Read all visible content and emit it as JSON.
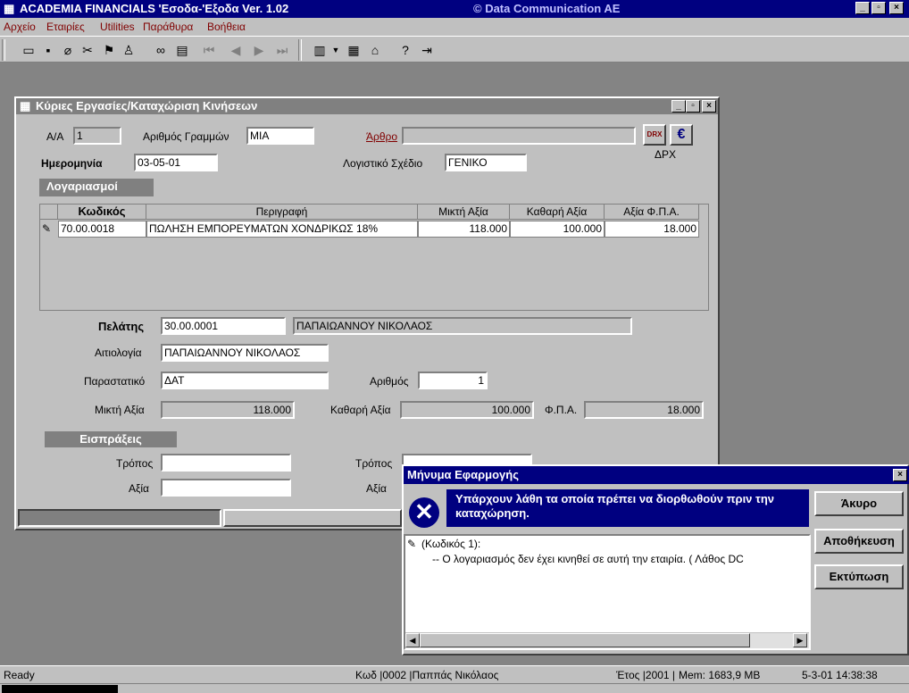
{
  "app": {
    "title": "ACADEMIA FINANCIALS 'Εσοδα-'Εξοδα Ver. 1.02",
    "company": "© Data Communication AE",
    "controls": {
      "minimize": "_",
      "maximize": "▫",
      "close": "×"
    }
  },
  "menu": [
    "Αρχείο",
    "Εταιρίες",
    "Utilities",
    "Παράθυρα",
    "Βοήθεια"
  ],
  "toolbar": {
    "icons": [
      "open-icon",
      "save-icon",
      "eraser-icon",
      "cut-icon",
      "flag-icon",
      "users-icon",
      "binoculars-icon",
      "calendar-icon",
      "first-record-icon",
      "prev-record-icon",
      "next-record-icon",
      "last-record-icon",
      "columns-icon",
      "list-icon",
      "building-icon",
      "help-icon",
      "exit-icon"
    ]
  },
  "child": {
    "title": "Κύριες Εργασίες/Καταχώριση Κινήσεων",
    "aa_label": "Α/Α",
    "aa_value": "1",
    "lines_label": "Αριθμός Γραμμών",
    "lines_value": "ΜΙΑ",
    "article_label": "Άρθρο",
    "article_value": "",
    "drx_label": "ΔΡΧ",
    "date_label": "Ημερομηνία",
    "date_value": "03-05-01",
    "plan_label": "Λογιστικό Σχέδιο",
    "plan_value": "ΓΕΝΙΚΟ",
    "accounts_header": "Λογαριασμοί",
    "grid": {
      "headers": [
        "Κωδικός",
        "Περιγραφή",
        "Μικτή Αξία",
        "Καθαρή Αξία",
        "Αξία Φ.Π.Α."
      ],
      "rows": [
        {
          "code": "70.00.0018",
          "desc": "ΠΩΛΗΣΗ ΕΜΠΟΡΕΥΜΑΤΩΝ ΧΟΝΔΡΙΚΩΣ 18%",
          "gross": "118.000",
          "net": "100.000",
          "vat": "18.000"
        }
      ]
    },
    "customer_label": "Πελάτης",
    "customer_code": "30.00.0001",
    "customer_name": "ΠΑΠΑΙΩΑΝΝΟΥ ΝΙΚΟΛΑΟΣ",
    "reason_label": "Αιτιολογία",
    "reason_value": "ΠΑΠΑΙΩΑΝΝΟΥ ΝΙΚΟΛΑΟΣ",
    "doc_label": "Παραστατικό",
    "doc_value": "ΔΑΤ",
    "number_label": "Αριθμός",
    "number_value": "1",
    "gross_label": "Μικτή Αξία",
    "gross_value": "118.000",
    "net_label": "Καθαρή Αξία",
    "net_value": "100.000",
    "vat_label": "Φ.Π.Α.",
    "vat_value": "18.000",
    "receipts_header": "Εισπράξεις",
    "method_label": "Τρόπος",
    "amount_label": "Αξία",
    "method2_label": "Τρόπος",
    "amount2_label": "Αξία"
  },
  "dialog": {
    "title": "Μήνυμα Εφαρμογής",
    "message": "Υπάρχουν λάθη τα οποία πρέπει να διορθωθούν πριν την καταχώρηση.",
    "tree_node": "(Κωδικός 1):",
    "tree_child": "-- Ο λογαριασμός δεν έχει κινηθεί σε αυτή την εταιρία. ( Λάθος DC",
    "buttons": {
      "cancel": "Άκυρο",
      "save": "Αποθήκευση",
      "print": "Εκτύπωση"
    },
    "close": "×"
  },
  "status": {
    "ready": "Ready",
    "code": "Κωδ |0002 |Παππάς Νικόλαος",
    "year": "Έτος |2001 |",
    "mem": "Mem: 1683,9 MB",
    "datetime": "5-3-01 14:38:38"
  },
  "colors": {
    "titlebar": "#000080",
    "child_title": "#808080",
    "accent_red": "#800000"
  }
}
